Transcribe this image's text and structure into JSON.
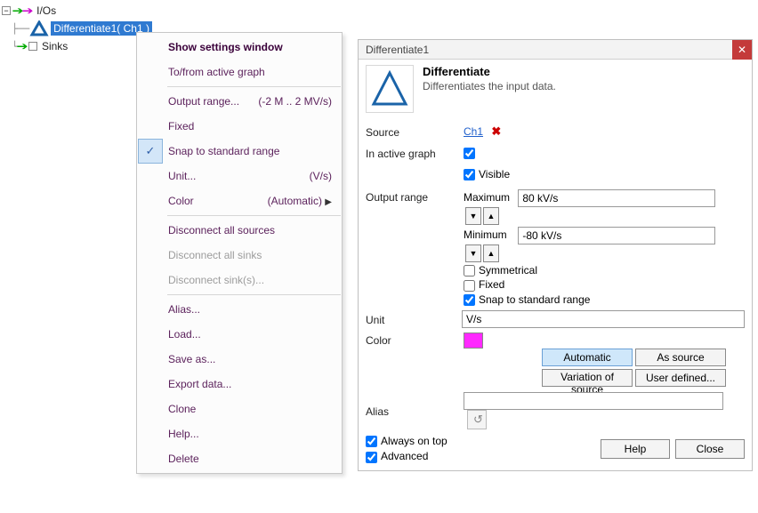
{
  "tree": {
    "root": "I/Os",
    "node_sel": "Differentiate1( Ch1 )",
    "sinks": "Sinks"
  },
  "ctx": {
    "show_settings": "Show settings window",
    "to_from_graph": "To/from active graph",
    "output_range": "Output range...",
    "output_range_hint": "(-2 M .. 2 MV/s)",
    "fixed": "Fixed",
    "snap": "Snap to standard range",
    "unit": "Unit...",
    "unit_hint": "(V/s)",
    "color": "Color",
    "color_hint": "(Automatic)",
    "disc_sources": "Disconnect all sources",
    "disc_sinks": "Disconnect all sinks",
    "disc_sink_sel": "Disconnect sink(s)...",
    "alias": "Alias...",
    "load": "Load...",
    "saveas": "Save as...",
    "export": "Export data...",
    "clone": "Clone",
    "help": "Help...",
    "delete": "Delete"
  },
  "sw": {
    "title": "Differentiate1",
    "hdr_title": "Differentiate",
    "hdr_desc": "Differentiates the input data.",
    "labels": {
      "source": "Source",
      "in_active_graph": "In active graph",
      "visible": "Visible",
      "output_range": "Output range",
      "maximum": "Maximum",
      "minimum": "Minimum",
      "symmetrical": "Symmetrical",
      "fixed": "Fixed",
      "snap": "Snap to standard range",
      "unit": "Unit",
      "color": "Color",
      "alias": "Alias",
      "always_on_top": "Always on top",
      "advanced": "Advanced"
    },
    "values": {
      "source_link": "Ch1",
      "maximum": "80 kV/s",
      "minimum": "-80 kV/s",
      "unit": "V/s",
      "alias": "",
      "color_hex": "#ff29ff"
    },
    "color_buttons": {
      "automatic": "Automatic",
      "as_source": "As source",
      "variation": "Variation of source",
      "user_defined": "User defined..."
    },
    "buttons": {
      "help": "Help",
      "close": "Close"
    }
  }
}
